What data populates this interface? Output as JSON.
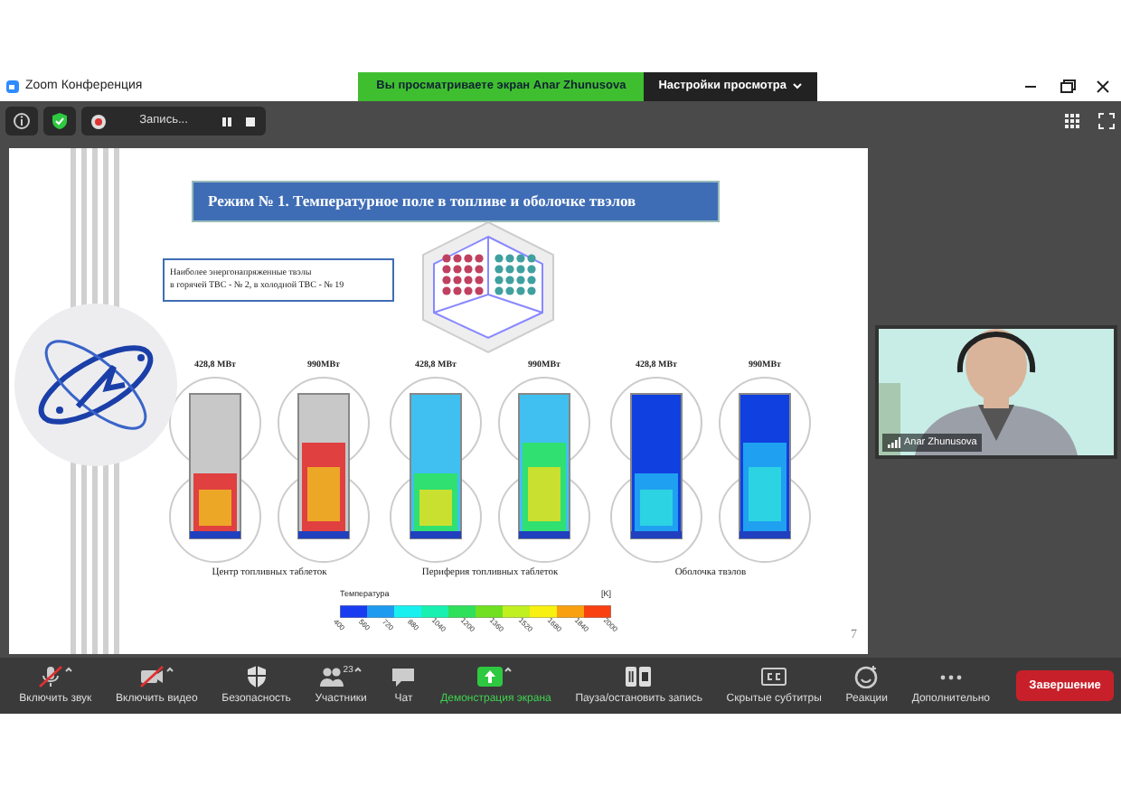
{
  "window": {
    "title": "Zoom Конференция"
  },
  "share_banner": {
    "text": "Вы просматриваете экран Anar Zhunusova",
    "options": "Настройки просмотра"
  },
  "recording": {
    "label": "Запись..."
  },
  "slide": {
    "title": "Режим № 1. Температурное поле в топливе и оболочке твэлов",
    "note": [
      "Наиболее энергонапряженные твэлы",
      "в горячей ТВС - № 2, в холодной ТВС - № 19"
    ],
    "groups": [
      {
        "caption": "Центр топливных таблеток",
        "kind": "center",
        "renders": [
          {
            "label": "428,8 МВт"
          },
          {
            "label": "990МВт"
          }
        ]
      },
      {
        "caption": "Периферия топливных таблеток",
        "kind": "periphery",
        "renders": [
          {
            "label": "428,8 МВт"
          },
          {
            "label": "990МВт"
          }
        ]
      },
      {
        "caption": "Оболочка твэлов",
        "kind": "cladding",
        "renders": [
          {
            "label": "428,8 МВт"
          },
          {
            "label": "990МВт"
          }
        ]
      }
    ],
    "legend": {
      "title": "Температура",
      "unit": "[K]",
      "ticks": [
        "400",
        "560",
        "720",
        "880",
        "1040",
        "1200",
        "1360",
        "1520",
        "1680",
        "1840",
        "2000"
      ]
    },
    "page": "7"
  },
  "video": {
    "name": "Anar Zhunusova"
  },
  "toolbar": [
    {
      "label": "Включить звук",
      "kind": "mic",
      "crossed": true,
      "caret": true,
      "active": false
    },
    {
      "label": "Включить видео",
      "kind": "camera",
      "crossed": true,
      "caret": true,
      "active": false
    },
    {
      "label": "Безопасность",
      "kind": "shield",
      "crossed": false,
      "caret": false,
      "active": false
    },
    {
      "label": "Участники",
      "kind": "people",
      "count": "23",
      "crossed": false,
      "caret": true,
      "active": false
    },
    {
      "label": "Чат",
      "kind": "chat",
      "crossed": false,
      "caret": false,
      "active": false
    },
    {
      "label": "Демонстрация экрана",
      "kind": "share",
      "crossed": false,
      "caret": true,
      "active": true
    },
    {
      "label": "Пауза/остановить запись",
      "kind": "pause",
      "crossed": false,
      "caret": false,
      "active": false
    },
    {
      "label": "Скрытые субтитры",
      "kind": "cc",
      "crossed": false,
      "caret": false,
      "active": false
    },
    {
      "label": "Реакции",
      "kind": "smile",
      "crossed": false,
      "caret": false,
      "active": false
    },
    {
      "label": "Дополнительно",
      "kind": "more",
      "crossed": false,
      "caret": false,
      "active": false
    }
  ],
  "end_button": "Завершение"
}
